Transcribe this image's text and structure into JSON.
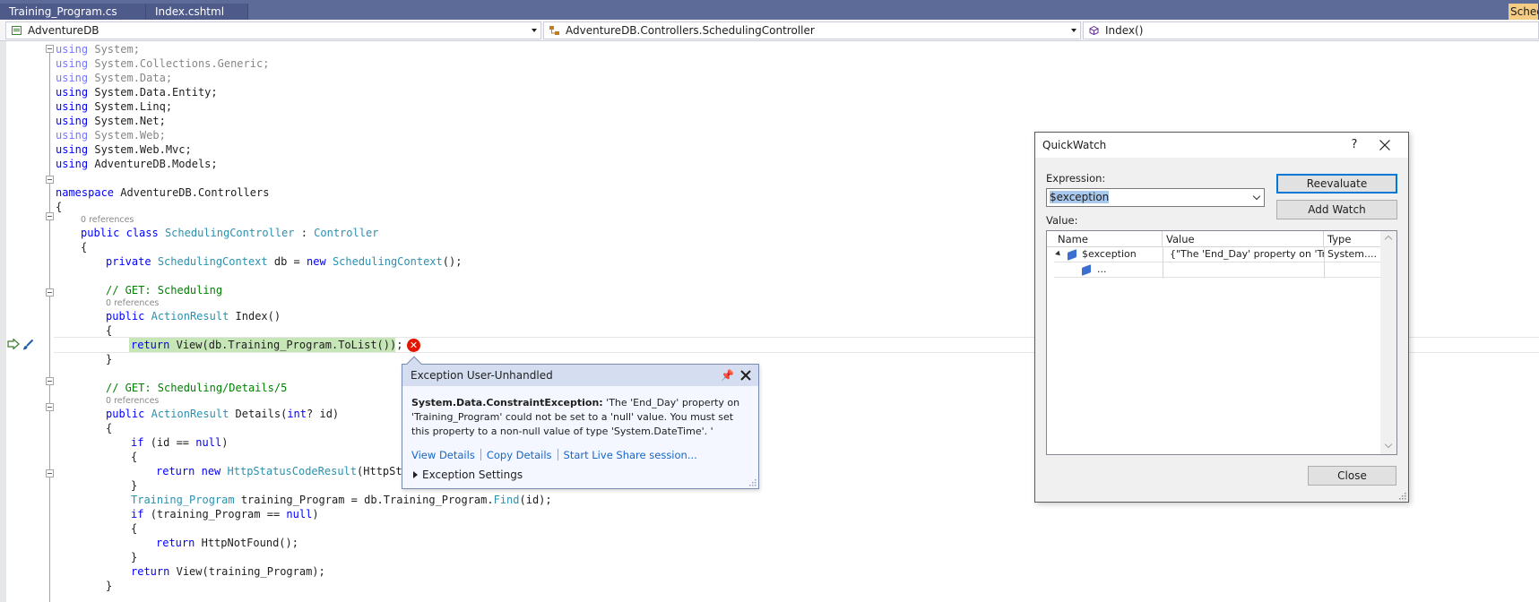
{
  "tabs": [
    {
      "label": "Training_Program.cs"
    },
    {
      "label": "Index.cshtml"
    },
    {
      "label": "Schedu"
    }
  ],
  "navbar": {
    "project": "AdventureDB",
    "class": "AdventureDB.Controllers.SchedulingController",
    "member": "Index()"
  },
  "code": {
    "using_kw": "using",
    "usings": [
      "System;",
      "System.Collections.Generic;",
      "System.Data;",
      "System.Data.Entity;",
      "System.Linq;",
      "System.Net;",
      "System.Web;",
      "System.Web.Mvc;",
      "AdventureDB.Models;"
    ],
    "namespace_kw": "namespace",
    "namespace_name": "AdventureDB.Controllers",
    "open_brace": "{",
    "close_brace": "}",
    "references": "0 references",
    "public_kw": "public",
    "class_kw": "class",
    "class_name": "SchedulingController",
    "class_sep": ":",
    "base_class": "Controller",
    "private_kw": "private",
    "context_type": "SchedulingContext",
    "field_rest": "db =",
    "new_kw": "new",
    "field_end": "();",
    "comment_index": "// GET: Scheduling",
    "action_result": "ActionResult",
    "index_sig": "Index()",
    "return_kw": "return",
    "return_index": "View(db.Training_Program.ToList());",
    "comment_details": "// GET: Scheduling/Details/5",
    "details_name": "Details(",
    "int_kw": "int",
    "details_param": "? id)",
    "if_kw": "if",
    "if_id": "(id ==",
    "null_kw": "null",
    "paren_close": ")",
    "http_status": "HttpStatusCodeResult",
    "http_status_arg": "(HttpSta",
    "tp_type": "Training_Program",
    "tp_assign": "training_Program = db.Training_Program.",
    "find_method": "Find",
    "find_arg": "(id);",
    "if_tp": "(training_Program ==",
    "not_found": "HttpNotFound();",
    "return_view": "View(training_Program);"
  },
  "exception_popup": {
    "title": "Exception User-Unhandled",
    "pin_glyph": "📌",
    "exception_type": "System.Data.ConstraintException:",
    "message": "'The 'End_Day' property on 'Training_Program' could not be set to a 'null' value. You must set this property to a non-null value of type 'System.DateTime'. '",
    "link_view_details": "View Details",
    "link_copy_details": "Copy Details",
    "link_live_share": "Start Live Share session...",
    "settings_label": "Exception Settings"
  },
  "quickwatch": {
    "title": "QuickWatch",
    "help_glyph": "?",
    "expression_label": "Expression:",
    "expression_value": "$exception",
    "reevaluate_label": "Reevaluate",
    "add_watch_label": "Add Watch",
    "value_label": "Value:",
    "columns": [
      "Name",
      "Value",
      "Type"
    ],
    "rows": [
      {
        "name": "$exception",
        "value": "{\"The 'End_Day' property on 'Tr...",
        "type": "System...."
      },
      {
        "name": "..."
      }
    ],
    "close_label": "Close"
  },
  "colors": {
    "tabbar": "#5d6b99",
    "active_tab": "#f5cc84",
    "keyword": "#0000ff",
    "type": "#2b91af",
    "comment": "#008000",
    "statement_highlight": "#c6e6b8",
    "error": "#e51400",
    "link": "#1a66c2"
  },
  "icons": [
    "project-icon",
    "class-icon",
    "method-icon",
    "breakpoint-arrow-icon",
    "brush-icon",
    "error-icon",
    "pin-icon",
    "close-icon",
    "expand-arrow-icon",
    "object-icon",
    "dropdown-icon",
    "help-icon"
  ]
}
